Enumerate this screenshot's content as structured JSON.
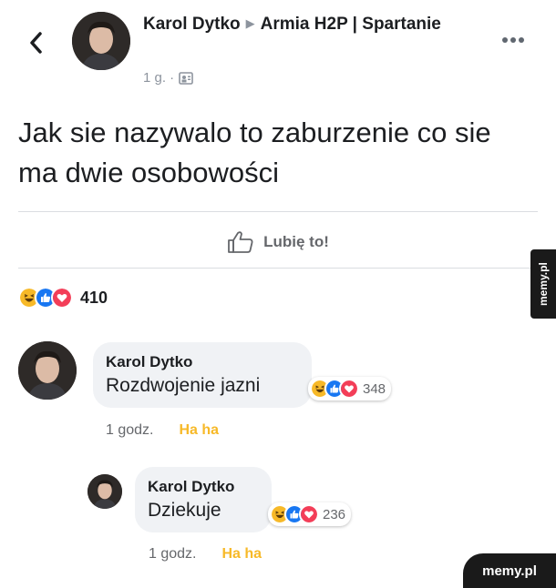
{
  "post": {
    "author": "Karol Dytko",
    "group": "Armia H2P | Spartanie",
    "time": "1 g. ·",
    "text": "Jak sie nazywalo to zaburzenie co sie ma dwie osobowości",
    "like_label": "Lubię to!",
    "reaction_count": "410"
  },
  "comments": [
    {
      "author": "Karol Dytko",
      "text": "Rozdwojenie jazni",
      "reaction_count": "348",
      "time": "1 godz.",
      "reaction_label": "Ha ha"
    },
    {
      "author": "Karol Dytko",
      "text": "Dziekuje",
      "reaction_count": "236",
      "time": "1 godz.",
      "reaction_label": "Ha ha"
    }
  ],
  "watermarks": {
    "side": "memy.pl",
    "bottom": "memy.pl"
  },
  "icons": {
    "back": "chevron-left-icon",
    "more": "more-dots-icon",
    "privacy": "group-privacy-icon",
    "like": "thumbs-up-icon",
    "reactions": [
      "haha-reaction-icon",
      "like-reaction-icon",
      "love-reaction-icon"
    ]
  },
  "colors": {
    "secondary_text": "#65676b",
    "haha": "#f7b928",
    "like_blue": "#1877f2",
    "love_red": "#f33e58",
    "bubble_bg": "#f0f2f5"
  }
}
